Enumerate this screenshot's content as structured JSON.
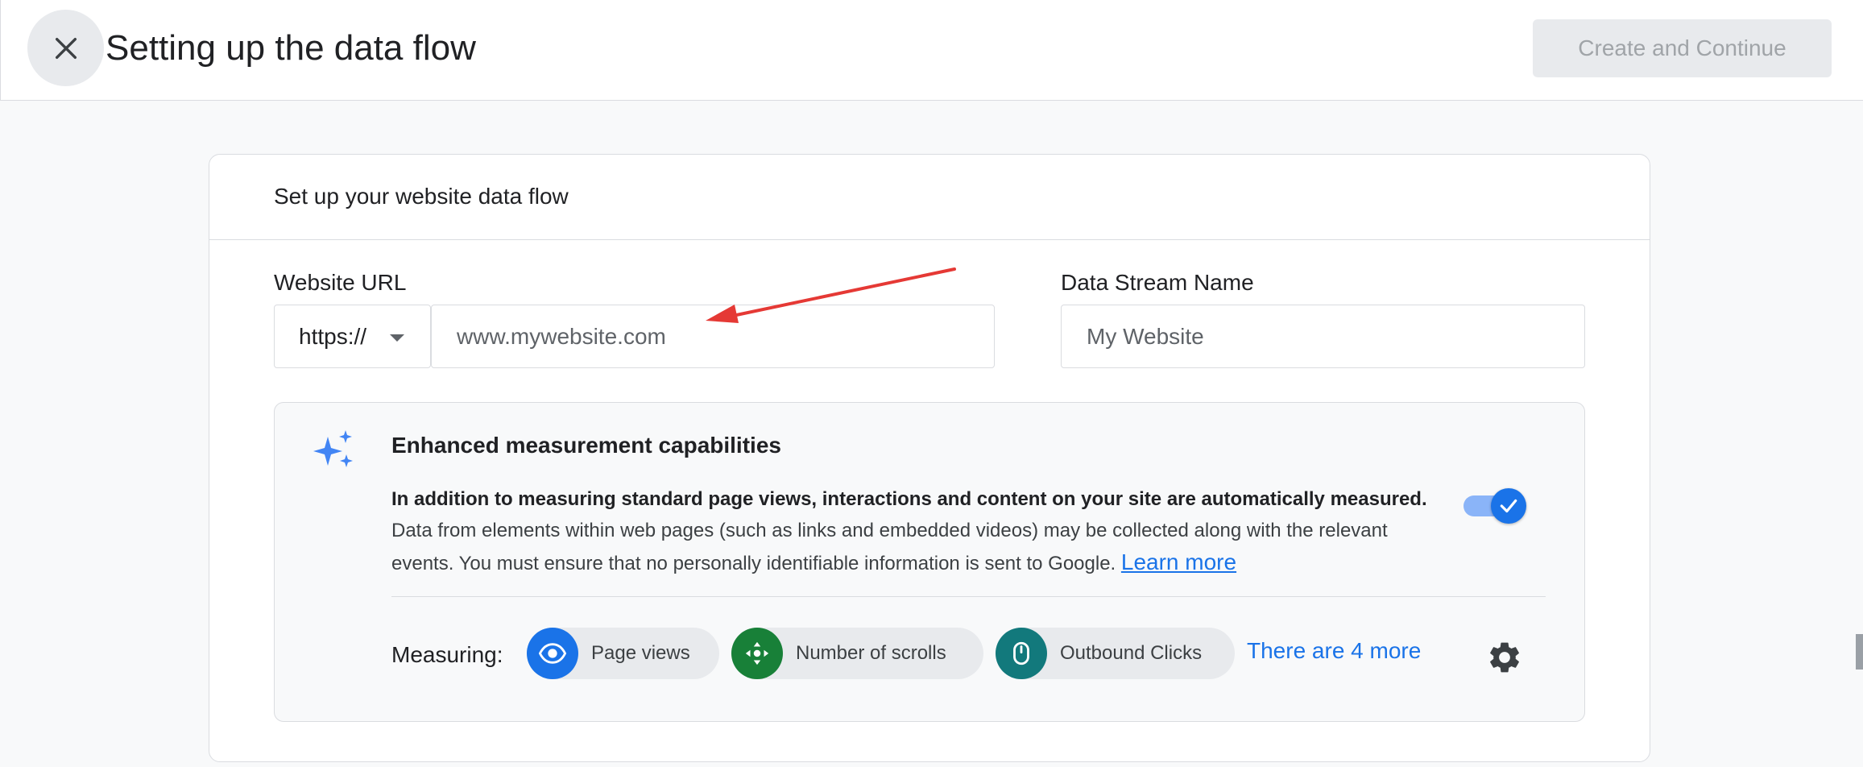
{
  "header": {
    "title": "Setting up the data flow",
    "create_label": "Create and Continue"
  },
  "card": {
    "header_text": "Set up your website data flow",
    "url_label": "Website URL",
    "protocol_value": "https://",
    "url_placeholder": "www.mywebsite.com",
    "stream_label": "Data Stream Name",
    "stream_placeholder": "My Website"
  },
  "enhanced": {
    "title": "Enhanced measurement capabilities",
    "desc_bold": "In addition to measuring standard page views, interactions and content on your site are automatically measured.",
    "desc_rest": "Data from elements within web pages (such as links and embedded videos) may be collected along with the relevant events. You must ensure that no personally identifiable information is sent to Google.",
    "learn_more": "Learn more",
    "toggle_on": true,
    "measuring_label": "Measuring:",
    "chips": [
      {
        "label": "Page views",
        "icon": "eye-icon",
        "color": "#1a73e8"
      },
      {
        "label": "Number of scrolls",
        "icon": "scroll-arrows-icon",
        "color": "#188038"
      },
      {
        "label": "Outbound Clicks",
        "icon": "mouse-icon",
        "color": "#12797c"
      }
    ],
    "more_link": "There are 4 more"
  },
  "colors": {
    "accent": "#1a73e8",
    "annotation_arrow": "#e53935"
  }
}
